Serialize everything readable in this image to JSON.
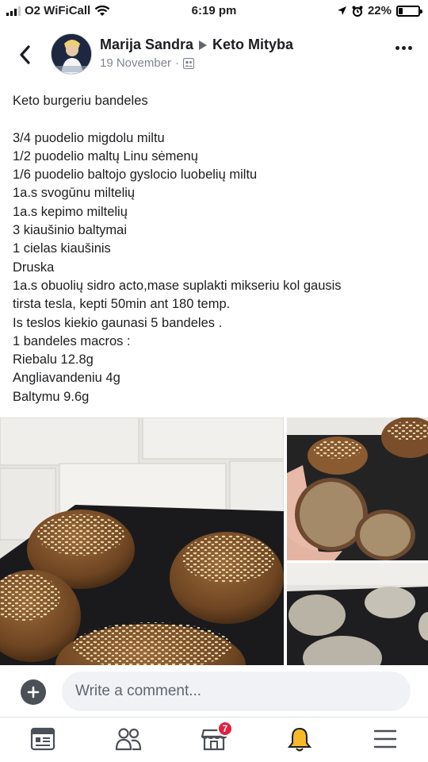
{
  "status_bar": {
    "carrier": "O2 WiFiCall",
    "time": "6:19 pm",
    "battery": "22%",
    "battery_level": 0.22
  },
  "post": {
    "author": "Marija Sandra",
    "group": "Keto Mityba",
    "date": "19 November",
    "separator": "·",
    "lines": [
      "Keto burgeriu bandeles",
      "",
      "3/4 puodelio migdolu miltu",
      "1/2 puodelio maltų Linu sėmenų",
      "1/6 puodelio baltojo gyslocio luobelių miltu",
      "1a.s svogūnu miltelių",
      "1a.s kepimo miltelių",
      "3 kiaušinio baltymai",
      "1 cielas kiaušinis",
      "Druska",
      "1a.s obuolių sidro acto,mase suplakti mikseriu kol gausis",
      "tirsta tesla, kepti 50min ant 180 temp.",
      "Is teslos kiekio gaunasi 5 bandeles .",
      "1 bandeles macros :",
      "Riebalu 12.8g",
      "Angliavandeniu 4g",
      "Baltymu 9.6g"
    ]
  },
  "comment": {
    "placeholder": "Write a comment..."
  },
  "nav": {
    "notifications_badge": "7"
  },
  "icons": {
    "back": "chevron-left-icon",
    "more": "more-dots-icon",
    "privacy": "group-privacy-icon",
    "plus": "plus-icon",
    "feed": "news-feed-icon",
    "groups": "groups-icon",
    "marketplace": "marketplace-icon",
    "notifications": "bell-icon",
    "menu": "menu-icon"
  },
  "colors": {
    "text": "#1c1e21",
    "meta": "#7f8590",
    "badge": "#e41e3f",
    "bell": "#f7b928"
  }
}
